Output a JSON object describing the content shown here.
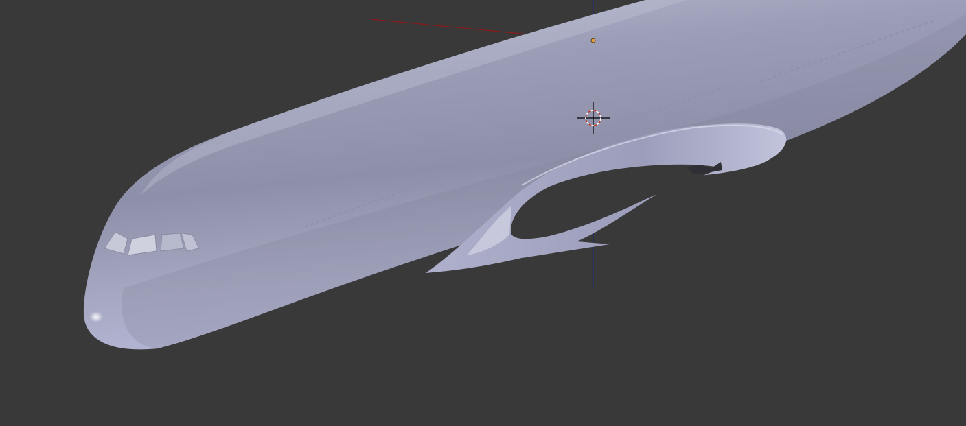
{
  "viewport": {
    "background_color": "#393939",
    "object_color": "#a9abc6",
    "highlight_color": "#d2d4e2",
    "shadow_color": "#5f617a",
    "x_axis_color": "#8a1c1c",
    "z_axis_color": "#1f2a7a",
    "origin_color": "#e0a040",
    "cursor_ring_color": "#c0392b"
  },
  "scene": {
    "object_icon": "aircraft-fuselage-mesh",
    "cursor_icon": "3d-cursor-icon",
    "origin_icon": "object-origin-dot"
  }
}
